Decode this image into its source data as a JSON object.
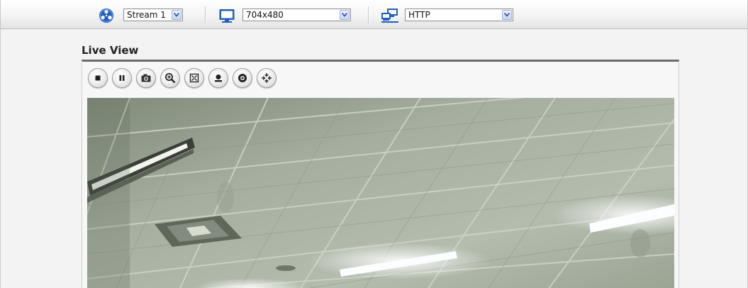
{
  "toolbar": {
    "stream": {
      "icon": "stream-film-reel-icon",
      "value": "Stream 1"
    },
    "resolution": {
      "icon": "monitor-icon",
      "value": "704x480"
    },
    "protocol": {
      "icon": "network-computers-icon",
      "value": "HTTP"
    }
  },
  "live_view": {
    "title": "Live View",
    "controls": [
      {
        "name": "stop-button",
        "icon": "stop-icon"
      },
      {
        "name": "pause-button",
        "icon": "pause-icon"
      },
      {
        "name": "snapshot-button",
        "icon": "camera-icon"
      },
      {
        "name": "digital-zoom-button",
        "icon": "zoom-in-icon"
      },
      {
        "name": "fullscreen-button",
        "icon": "fullscreen-icon"
      },
      {
        "name": "record-button",
        "icon": "record-icon"
      },
      {
        "name": "audio-button",
        "icon": "speaker-icon"
      },
      {
        "name": "view-size-button",
        "icon": "resize-arrows-icon"
      }
    ]
  },
  "colors": {
    "title_rule": "#6b6b6b",
    "toolbar_icon_blue": "#1f5fc0",
    "dropdown_arrow": "#3158b5"
  }
}
